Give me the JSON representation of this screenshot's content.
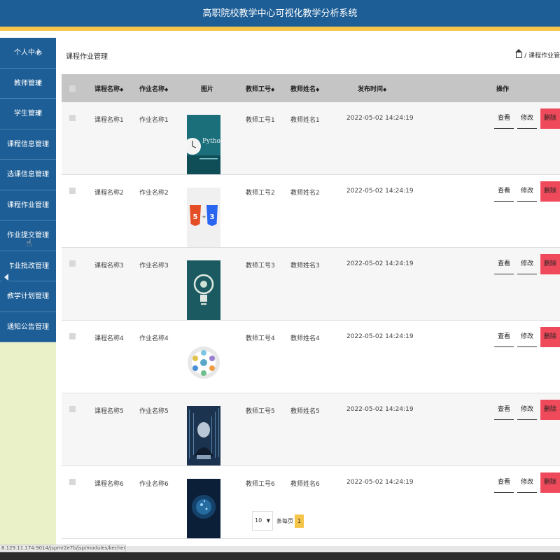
{
  "app": {
    "title": "高职院校教学中心可视化教学分析系统"
  },
  "sidebar": {
    "items": [
      {
        "label": "个人中心",
        "has_caret": true
      },
      {
        "label": "教师管理",
        "has_caret": true
      },
      {
        "label": "学生管理",
        "has_caret": true
      },
      {
        "label": "课程信息管理",
        "has_caret": false
      },
      {
        "label": "选课信息管理",
        "has_caret": false
      },
      {
        "label": "课程作业管理",
        "has_caret": false
      },
      {
        "label": "作业提交管理",
        "has_caret": false
      },
      {
        "label": "作业批改管理",
        "has_caret": false
      },
      {
        "label": "教学计划管理",
        "has_caret": false
      },
      {
        "label": "通知公告管理",
        "has_caret": false
      }
    ],
    "caret_glyph": "▼"
  },
  "page": {
    "heading": "课程作业管理",
    "breadcrumb": "/ 课程作业管"
  },
  "table": {
    "sort_glyph": "◆",
    "headers": {
      "course_name": "课程名称",
      "homework_name": "作业名称",
      "image": "图片",
      "teacher_id": "教师工号",
      "teacher_name": "教师姓名",
      "publish_time": "发布时间",
      "actions": "操作"
    },
    "action_labels": {
      "view": "查看",
      "edit": "修改",
      "delete": "删除"
    },
    "rows": [
      {
        "course_name": "课程名称1",
        "homework_name": "作业名称1",
        "image": "python-clock-icon",
        "teacher_id": "教师工号1",
        "teacher_name": "教师姓名1",
        "publish_time": "2022-05-02 14:24:19"
      },
      {
        "course_name": "课程名称2",
        "homework_name": "作业名称2",
        "image": "html5-css3-icon",
        "teacher_id": "教师工号2",
        "teacher_name": "教师姓名2",
        "publish_time": "2022-05-02 14:24:19"
      },
      {
        "course_name": "课程名称3",
        "homework_name": "作业名称3",
        "image": "lightbulb-icon",
        "teacher_id": "教师工号3",
        "teacher_name": "教师姓名3",
        "publish_time": "2022-05-02 14:24:19"
      },
      {
        "course_name": "课程名称4",
        "homework_name": "作业名称4",
        "image": "infographic-wheel-icon",
        "teacher_id": "教师工号4",
        "teacher_name": "教师姓名4",
        "publish_time": "2022-05-02 14:24:19"
      },
      {
        "course_name": "课程名称5",
        "homework_name": "作业名称5",
        "image": "hacker-code-icon",
        "teacher_id": "教师工号5",
        "teacher_name": "教师姓名5",
        "publish_time": "2022-05-02 14:24:19"
      },
      {
        "course_name": "课程名称6",
        "homework_name": "作业名称6",
        "image": "ai-head-icon",
        "teacher_id": "教师工号6",
        "teacher_name": "教师姓名6",
        "publish_time": "2022-05-02 14:24:19"
      }
    ]
  },
  "pagination": {
    "page_size": "10",
    "per_page_label": "条每页",
    "current_page": "1"
  },
  "status_url": "8.129.11.174:9014/jspmr2e7b/jsp/modules/kechengzuoye/list.jsp#",
  "colors": {
    "primary": "#1d5e96",
    "accent": "#f5c54a",
    "danger": "#ef4a5b",
    "sidebar_bg": "#eaf0c7"
  }
}
